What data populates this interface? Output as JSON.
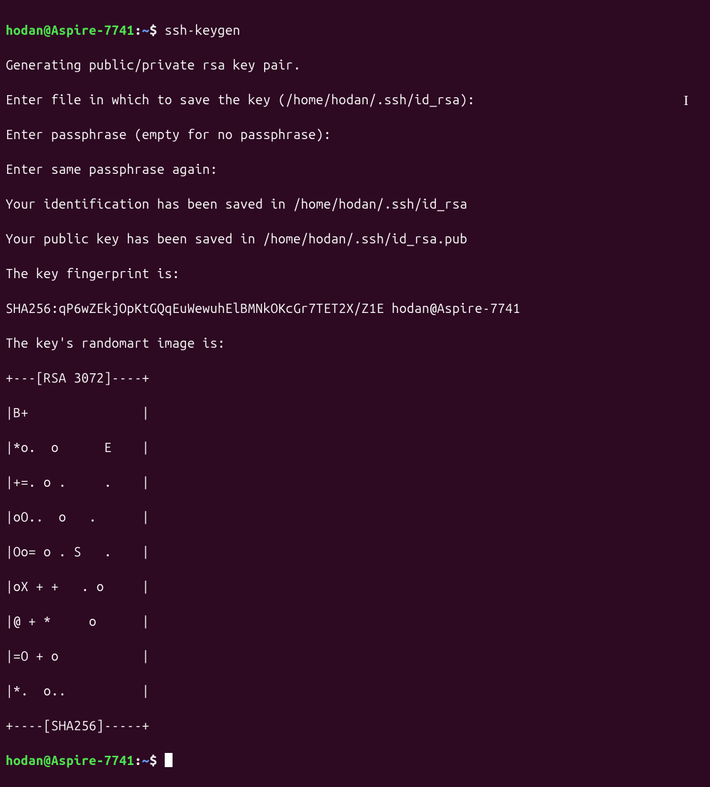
{
  "prompt1": {
    "user_host": "hodan@Aspire-7741",
    "colon": ":",
    "path": "~",
    "dollar": "$",
    "command": " ssh-keygen"
  },
  "output_lines": [
    "Generating public/private rsa key pair.",
    "Enter file in which to save the key (/home/hodan/.ssh/id_rsa):",
    "Enter passphrase (empty for no passphrase):",
    "Enter same passphrase again:",
    "Your identification has been saved in /home/hodan/.ssh/id_rsa",
    "Your public key has been saved in /home/hodan/.ssh/id_rsa.pub",
    "The key fingerprint is:",
    "SHA256:qP6wZEkjOpKtGQqEuWewuhElBMNkOKcGr7TET2X/Z1E hodan@Aspire-7741",
    "The key's randomart image is:",
    "+---[RSA 3072]----+",
    "|B+               |",
    "|*o.  o      E    |",
    "|+=. o .     .    |",
    "|oO..  o   .      |",
    "|Oo= o . S   .    |",
    "|oX + +   . o     |",
    "|@ + *     o      |",
    "|=O + o           |",
    "|*.  o..          |",
    "+----[SHA256]-----+"
  ],
  "prompt2": {
    "user_host": "hodan@Aspire-7741",
    "colon": ":",
    "path": "~",
    "dollar": "$"
  },
  "ibeam_char": "I"
}
